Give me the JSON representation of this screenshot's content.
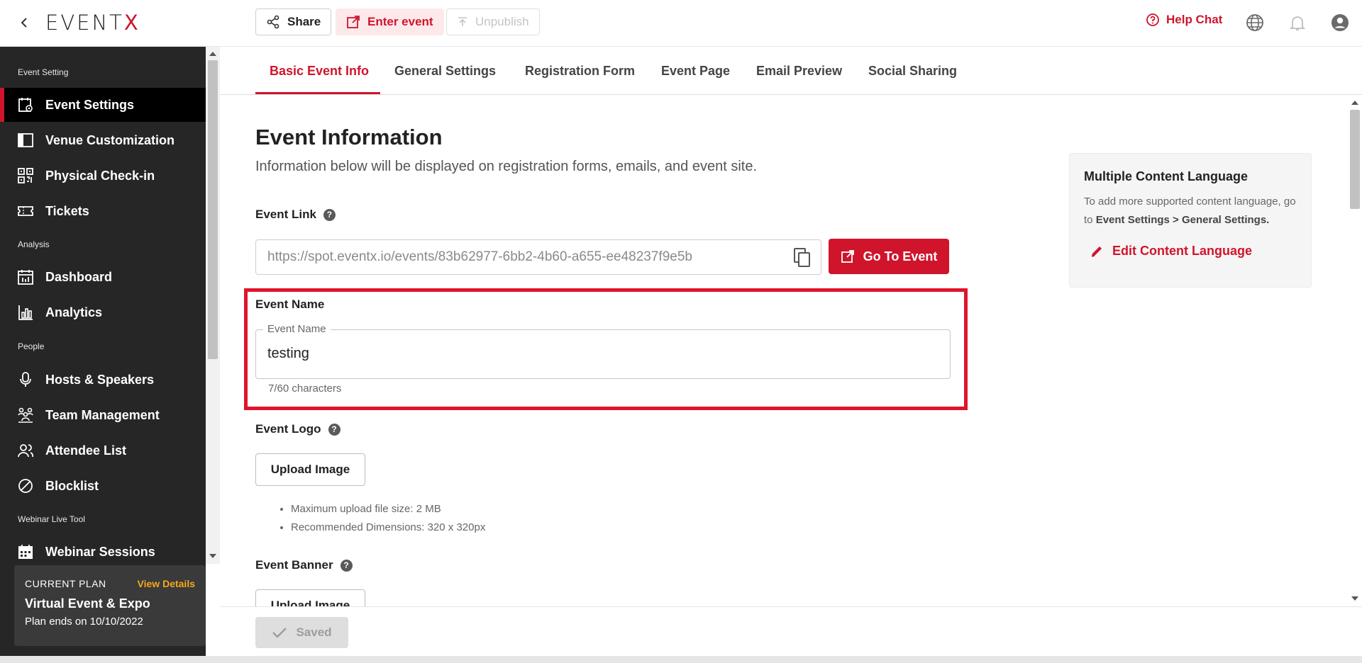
{
  "header": {
    "logo_text_main": "EVENT",
    "logo_text_x": "X",
    "share_label": "Share",
    "enter_label": "Enter event",
    "unpublish_label": "Unpublish",
    "help_chat_label": "Help Chat"
  },
  "sidebar": {
    "sections": {
      "event_setting": "Event Setting",
      "analysis": "Analysis",
      "people": "People",
      "webinar": "Webinar Live Tool"
    },
    "items": [
      {
        "label": "Event Settings",
        "icon": "settings-calendar-icon",
        "active": true
      },
      {
        "label": "Venue Customization",
        "icon": "layout-icon"
      },
      {
        "label": "Physical Check-in",
        "icon": "qr-code-icon"
      },
      {
        "label": "Tickets",
        "icon": "ticket-icon"
      },
      {
        "label": "Dashboard",
        "icon": "calendar-dashboard-icon"
      },
      {
        "label": "Analytics",
        "icon": "bar-chart-icon"
      },
      {
        "label": "Hosts & Speakers",
        "icon": "microphone-icon"
      },
      {
        "label": "Team Management",
        "icon": "team-icon"
      },
      {
        "label": "Attendee List",
        "icon": "people-icon"
      },
      {
        "label": "Blocklist",
        "icon": "block-icon"
      },
      {
        "label": "Webinar Sessions",
        "icon": "calendar-grid-icon"
      }
    ],
    "plan": {
      "label": "CURRENT PLAN",
      "view_details": "View Details",
      "name": "Virtual Event & Expo",
      "ends": "Plan ends on 10/10/2022"
    }
  },
  "tabs": [
    {
      "label": "Basic Event Info",
      "active": true
    },
    {
      "label": "General Settings"
    },
    {
      "label": "Registration Form"
    },
    {
      "label": "Event Page"
    },
    {
      "label": "Email Preview"
    },
    {
      "label": "Social Sharing"
    }
  ],
  "main": {
    "title": "Event Information",
    "subtitle": "Information below will be displayed on registration forms, emails, and event site.",
    "event_link_label": "Event Link",
    "event_link_value": "https://spot.eventx.io/events/83b62977-6bb2-4b60-a655-ee48237f9e5b",
    "go_to_event": "Go To Event",
    "event_name_label": "Event Name",
    "event_name_legend": "Event Name",
    "event_name_value": "testing",
    "char_count": "7/60 characters",
    "event_logo_label": "Event Logo",
    "upload_image": "Upload Image",
    "logo_hints": [
      "Maximum upload file size: 2 MB",
      "Recommended Dimensions: 320 x 320px"
    ],
    "event_banner_label": "Event Banner",
    "upload_image_2": "Upload Image",
    "saved_label": "Saved"
  },
  "lang_card": {
    "title": "Multiple Content Language",
    "text_prefix": "To add more supported content language, go to ",
    "text_bold": "Event Settings > General Settings.",
    "edit_label": "Edit Content Language"
  },
  "colors": {
    "accent": "#d0142c",
    "sidebar_bg": "#262626",
    "plan_link": "#f6a81b"
  }
}
